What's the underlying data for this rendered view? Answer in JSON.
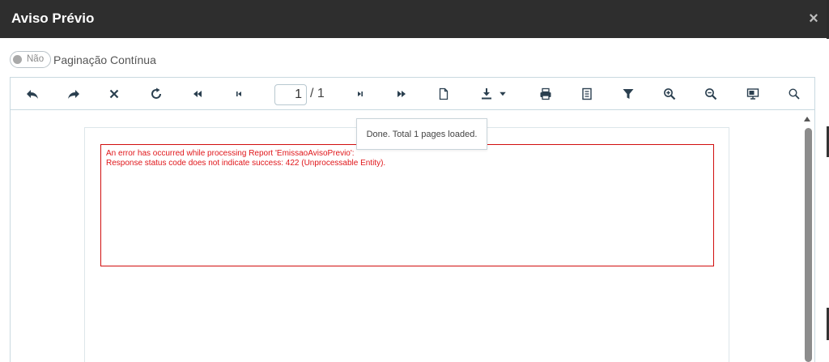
{
  "dialog": {
    "title": "Aviso Prévio",
    "close_glyph": "×"
  },
  "pagination_toggle": {
    "state_label": "Não",
    "label": "Paginação Contínua",
    "checked": false
  },
  "toolbar": {
    "icons": [
      "undo-icon",
      "redo-icon",
      "close-icon",
      "refresh-icon",
      "fast-backward-icon",
      "first-page-icon",
      "last-page-icon",
      "fast-forward-icon",
      "document-icon",
      "download-icon",
      "print-icon",
      "report-icon",
      "filter-icon",
      "zoom-in-icon",
      "zoom-out-icon",
      "display-icon",
      "search-icon"
    ],
    "current_page": "1",
    "total_pages": "/ 1"
  },
  "tooltip": {
    "text": "Done. Total 1 pages loaded."
  },
  "report": {
    "error_line_1": "An error has occurred while processing Report 'EmissaoAvisoPrevio':",
    "error_line_2": "Response status code does not indicate success: 422 (Unprocessable Entity)."
  },
  "colors": {
    "header_bg": "#2e2e2e",
    "error_red": "#e0161a",
    "toolbar_icon": "#2a3f4f"
  }
}
